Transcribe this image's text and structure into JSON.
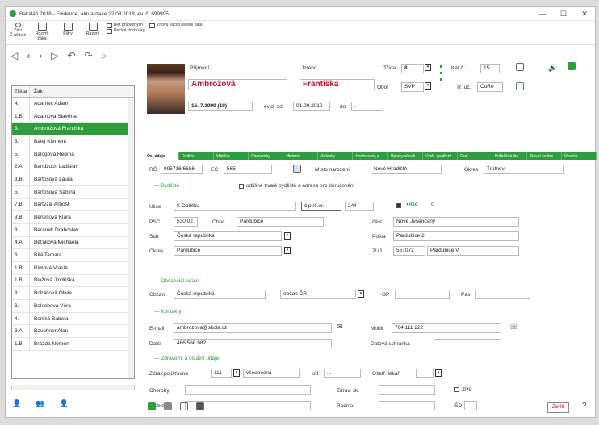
{
  "window": {
    "title": "Bakaláři 2018 - Evidence, aktualizace 22.08.2018, ev. č. 899995",
    "controls": [
      "—",
      "☐",
      "✕"
    ]
  },
  "ribbon": {
    "items": [
      {
        "label1": "Žáci",
        "label2": "Č učitelé"
      },
      {
        "label1": "Rozvrh",
        "label2": "žáka"
      },
      {
        "label1": "Filtry",
        "label2": ""
      },
      {
        "label1": "Řazení",
        "label2": ""
      }
    ],
    "small1": [
      "Bez průběžných",
      "Řecíné dochúzky"
    ],
    "small2": [
      "Znovu načíst osobní data"
    ]
  },
  "list": {
    "headers": [
      "Třída",
      "Žák"
    ],
    "rows": [
      {
        "cls": "4.",
        "name": "Adamec Adam"
      },
      {
        "cls": "1.B",
        "name": "Adamová Slavěna"
      },
      {
        "cls": "3.",
        "name": "Ambrožová Františka",
        "sel": true
      },
      {
        "cls": "8.",
        "name": "Balej Klement"
      },
      {
        "cls": "5.",
        "name": "Balogová Regína"
      },
      {
        "cls": "2.A",
        "name": "Bandžuch Ladislav"
      },
      {
        "cls": "3.B",
        "name": "Bartošová Laura"
      },
      {
        "cls": "5.",
        "name": "Bartošová Sabina"
      },
      {
        "cls": "7.B",
        "name": "Bartyzal Arnošt"
      },
      {
        "cls": "3.B",
        "name": "Benešová Klára"
      },
      {
        "cls": "8.",
        "name": "Beránek Drahoslav"
      },
      {
        "cls": "4.A",
        "name": "Běťáková Michaela"
      },
      {
        "cls": "6.",
        "name": "Bílá Tamara"
      },
      {
        "cls": "1.B",
        "name": "Bímová Vlasta"
      },
      {
        "cls": "1.B",
        "name": "Blažová Jindřiška"
      },
      {
        "cls": "8.",
        "name": "Boháčová Olivie"
      },
      {
        "cls": "6.",
        "name": "Bolechová Věra"
      },
      {
        "cls": "4.",
        "name": "Borská Babeta"
      },
      {
        "cls": "3.A",
        "name": "Bouchner Alan"
      },
      {
        "cls": "1.B",
        "name": "Brázda Norbert"
      }
    ]
  },
  "main": {
    "prijmeni_label": "Příjmení",
    "prijmeni": "Ambrožová",
    "jmeno_label": "Jméno",
    "jmeno": "Františka",
    "trida_label": "Třída:",
    "trida": "8.",
    "katc_label": "Kat.č.:",
    "katc": "15",
    "obor_label": "Obor",
    "obor": "SVP",
    "tuc_label": "Tř. uč.",
    "tuc": "CoRe",
    "datum": "16. 7.1999 (19)",
    "evid_label": "evid. od",
    "evid": "01.09.2010",
    "do_label": "do",
    "do": ". .",
    "tabs": [
      "Os. údaje",
      "Rodiče",
      "Matrika",
      "Poznámky",
      "Historie",
      "Známky",
      "Hodnocení, p",
      "Opravy zkouš",
      "Vých. opatření",
      "Graf",
      "Průběžná kla",
      "Slovní hodno",
      "Úvazky"
    ],
    "rc_label": "RČ",
    "rc": "995716/6686",
    "ec_label": "EČ",
    "ec": "565",
    "misto_label": "Místo narození",
    "misto": "Nové Hradiště",
    "okres_label": "Okres",
    "okres_nar": "Trutnov",
    "bydliste": "Bydliště",
    "odlisne": "odlišné trvalé bydliště a adresa pro doručování",
    "ulice_label": "Ulice",
    "ulice": "K Dolíčku",
    "cp_label": "č.p./č.or.",
    "cp": "244",
    "psc_label": "PSČ",
    "psc": "530 02",
    "obec_label": "Obec",
    "obec": "Pardubice",
    "cast_label": "část",
    "cast": "Nové Jesenčany",
    "stat_label": "Stát",
    "stat": "Česká republika",
    "posta_label": "Pošta",
    "posta": "Pardubice 2",
    "okres2_label": "Okres",
    "okres2": "Pardubice",
    "zuj_label": "ZUJ",
    "zuj": "557072",
    "zuj_name": "Pardubice V",
    "obcanske": "Občanské údaje",
    "obcan_label": "Občan",
    "obcan": "Česká republika",
    "obcan2": "občan ČR",
    "op_label": "OP",
    "pas_label": "Pas",
    "kontakty": "Kontakty",
    "email_label": "E-mail",
    "email": "ambrozova@skola.cz",
    "mobil_label": "Mobil",
    "mobil": "704 111 222",
    "dalsi_label": "Další",
    "dalsi": "466 566 982",
    "dschr_label": "Datová schránka",
    "zdrav": "Zdravotní a ostatní údaje",
    "zp_label": "Zdrav.pojišťovna",
    "zp_code": "111",
    "zp": "všeobecná",
    "od_label": "od",
    "od": ". .",
    "lekar_label": "Ošetř. lékař",
    "choroby_label": "Choroby",
    "zsk_label": "Zdrav. sk.",
    "zps": "ZPS",
    "problemy_label": "Problémy",
    "rodina_label": "Rodina",
    "sd": "ŠD",
    "zavrit": "Zavřít"
  }
}
